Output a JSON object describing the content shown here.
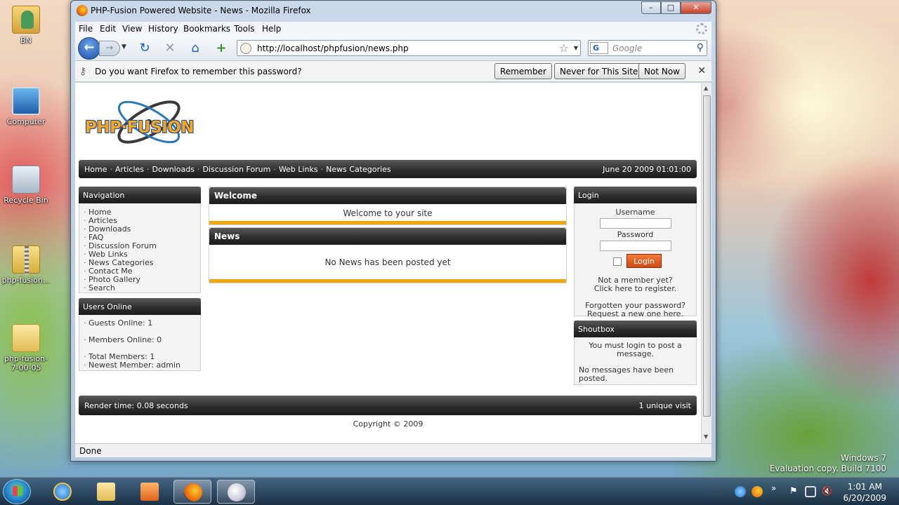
{
  "desktop": {
    "icons": [
      {
        "label": "BN",
        "icon": "user-folder-icon"
      },
      {
        "label": "Computer",
        "icon": "computer-icon"
      },
      {
        "label": "Recycle Bin",
        "icon": "recycle-bin-icon"
      },
      {
        "label": "php-fusion...",
        "icon": "zip-folder-icon"
      },
      {
        "label": "php-fusion-7-00-05",
        "icon": "folder-icon"
      }
    ],
    "watermark": {
      "line1": "Windows 7",
      "line2": "Evaluation copy. Build 7100"
    }
  },
  "taskbar": {
    "clock_time": "1:01 AM",
    "clock_date": "6/20/2009"
  },
  "window": {
    "title": "PHP-Fusion Powered Website - News - Mozilla Firefox",
    "controls": {
      "minimize": "–",
      "maximize": "□",
      "close": "✕"
    },
    "menu": [
      "File",
      "Edit",
      "View",
      "History",
      "Bookmarks",
      "Tools",
      "Help"
    ],
    "url": "http://localhost/phpfusion/news.php",
    "search_placeholder": "Google",
    "search_engine": "G",
    "notify": {
      "text": "Do you want Firefox to remember this password?",
      "remember": "Remember",
      "never": "Never for This Site",
      "not_now": "Not Now"
    },
    "status": "Done"
  },
  "site": {
    "logo_text": "PHP·FUSION",
    "main_menu": [
      "Home",
      "Articles",
      "Downloads",
      "Discussion Forum",
      "Web Links",
      "News Categories"
    ],
    "date": "June 20 2009 01:01:00",
    "navigation": {
      "title": "Navigation",
      "links": [
        "Home",
        "Articles",
        "Downloads",
        "FAQ",
        "Discussion Forum",
        "Web Links",
        "News Categories",
        "Contact Me",
        "Photo Gallery",
        "Search"
      ]
    },
    "users_online": {
      "title": "Users Online",
      "guests": "Guests Online: 1",
      "members": "Members Online: 0",
      "total": "Total Members: 1",
      "newest": "Newest Member: admin"
    },
    "welcome": {
      "title": "Welcome",
      "text": "Welcome to your site"
    },
    "news": {
      "title": "News",
      "text": "No News has been posted yet"
    },
    "login": {
      "title": "Login",
      "username_label": "Username",
      "password_label": "Password",
      "button": "Login",
      "not_member_1": "Not a member yet?",
      "not_member_2": "Click here to register.",
      "forgot_1": "Forgotten your password?",
      "forgot_2": "Request a new one here."
    },
    "shoutbox": {
      "title": "Shoutbox",
      "login_msg": "You must login to post a message.",
      "no_msgs": "No messages have been posted."
    },
    "footer": {
      "render_time": "Render time: 0.08 seconds",
      "visits": "1 unique visit",
      "copyright": "Copyright © 2009"
    }
  }
}
